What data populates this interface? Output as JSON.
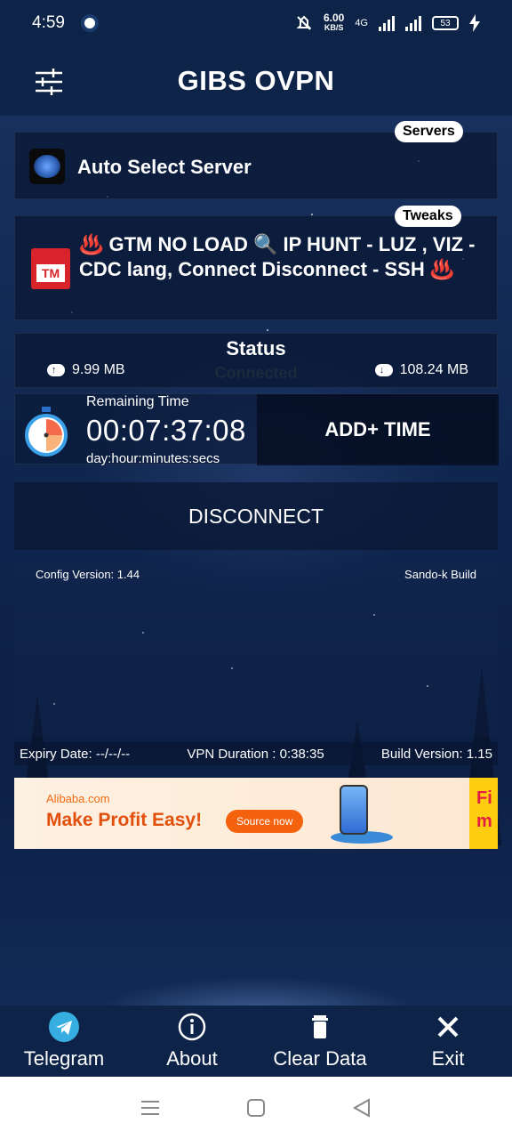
{
  "status_bar": {
    "time": "4:59",
    "speed_value": "6.00",
    "speed_unit": "KB/S",
    "network": "4G",
    "battery": "53"
  },
  "app_bar": {
    "title": "GIBS OVPN"
  },
  "server": {
    "pill": "Servers",
    "name": "Auto Select Server"
  },
  "tweak": {
    "pill": "Tweaks",
    "text": "♨️ GTM NO LOAD 🔍 IP HUNT - LUZ , VIZ - CDC lang, Connect Disconnect - SSH ♨️"
  },
  "status": {
    "title": "Status",
    "state": "Connected",
    "upload": "9.99 MB",
    "download": "108.24 MB"
  },
  "timer": {
    "label": "Remaining Time",
    "value": "00:07:37:08",
    "unit": "day:hour:minutes:secs",
    "add_button": "ADD+ TIME"
  },
  "disconnect_label": "DISCONNECT",
  "log": {
    "config_version": "Config Version: 1.44",
    "build_by": "Sando-k Build"
  },
  "info": {
    "expiry": "Expiry Date: --/--/--",
    "duration": "VPN Duration : 0:38:35",
    "build_version": "Build Version: 1.15"
  },
  "ad": {
    "brand": "Alibaba.com",
    "headline": "Make Profit Easy!",
    "button": "Source now",
    "side_text": "Fi m"
  },
  "bottom_nav": [
    {
      "label": "Telegram",
      "icon": "telegram-icon"
    },
    {
      "label": "About",
      "icon": "info-icon"
    },
    {
      "label": "Clear Data",
      "icon": "trash-icon"
    },
    {
      "label": "Exit",
      "icon": "close-icon"
    }
  ],
  "colors": {
    "accent": "#0d2448",
    "telegram": "#37aee2",
    "ad_orange": "#f5620e"
  }
}
